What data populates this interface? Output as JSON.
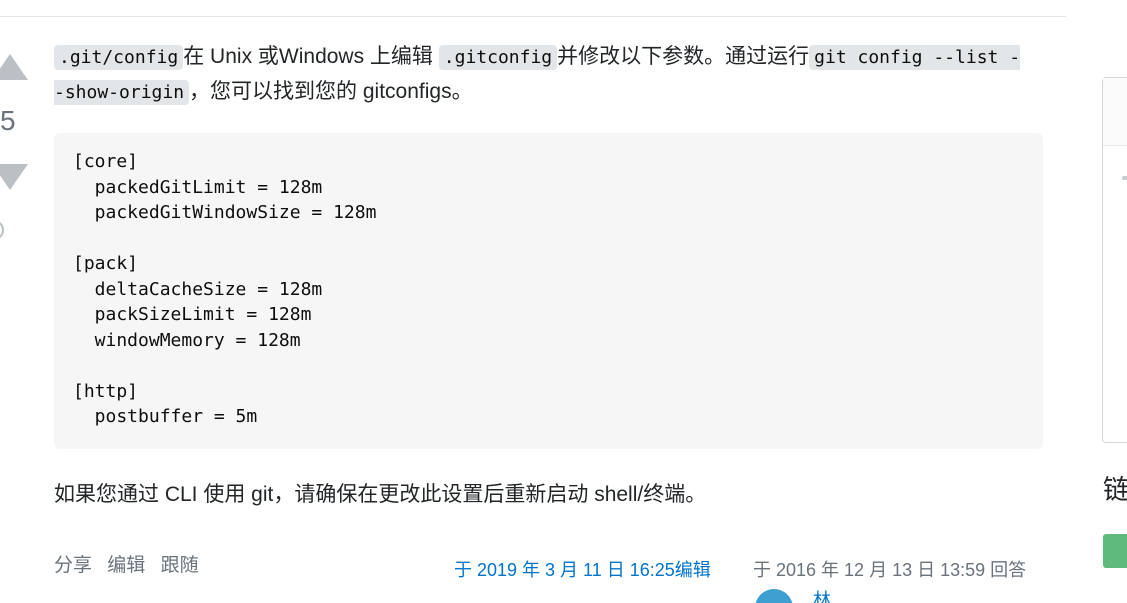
{
  "vote": {
    "count": "5",
    "up_icon": "arrow-up-icon",
    "down_icon": "arrow-down-icon",
    "history_icon": "clock-history-icon"
  },
  "post": {
    "intro": {
      "code_config": ".git/config",
      "text_1": "在 Unix 或Windows 上编辑",
      "code_gitconfig": ".gitconfig",
      "text_2": "并修改以下参数。通过运行",
      "code_command": "git config --list --show-origin",
      "text_3": "，您可以找到您的 gitconfigs。"
    },
    "code_block": [
      "[core]",
      "  packedGitLimit = 128m",
      "  packedGitWindowSize = 128m",
      "",
      "[pack]",
      "  deltaCacheSize = 128m",
      "  packSizeLimit = 128m",
      "  windowMemory = 128m",
      "",
      "[http]",
      "  postbuffer = 5m"
    ],
    "outro": "如果您通过 CLI 使用 git，请确保在更改此设置后重新启动 shell/终端。"
  },
  "post_menu": {
    "share": "分享",
    "edit": "编辑",
    "follow": "跟随"
  },
  "signature": {
    "edited": "于 2019 年 3 月 11 日 16:25编辑",
    "answered": "于 2016 年 12 月 13 日 13:59 回答",
    "user_name": "林"
  },
  "sidebar": {
    "heading": "链"
  },
  "colors": {
    "link": "#0074cc",
    "muted": "#6a737c",
    "code_bg": "#f6f6f6",
    "inline_code_bg": "#e3e6e8",
    "badge_green": "#5eba7d",
    "avatar_blue": "#3e9fd1"
  }
}
